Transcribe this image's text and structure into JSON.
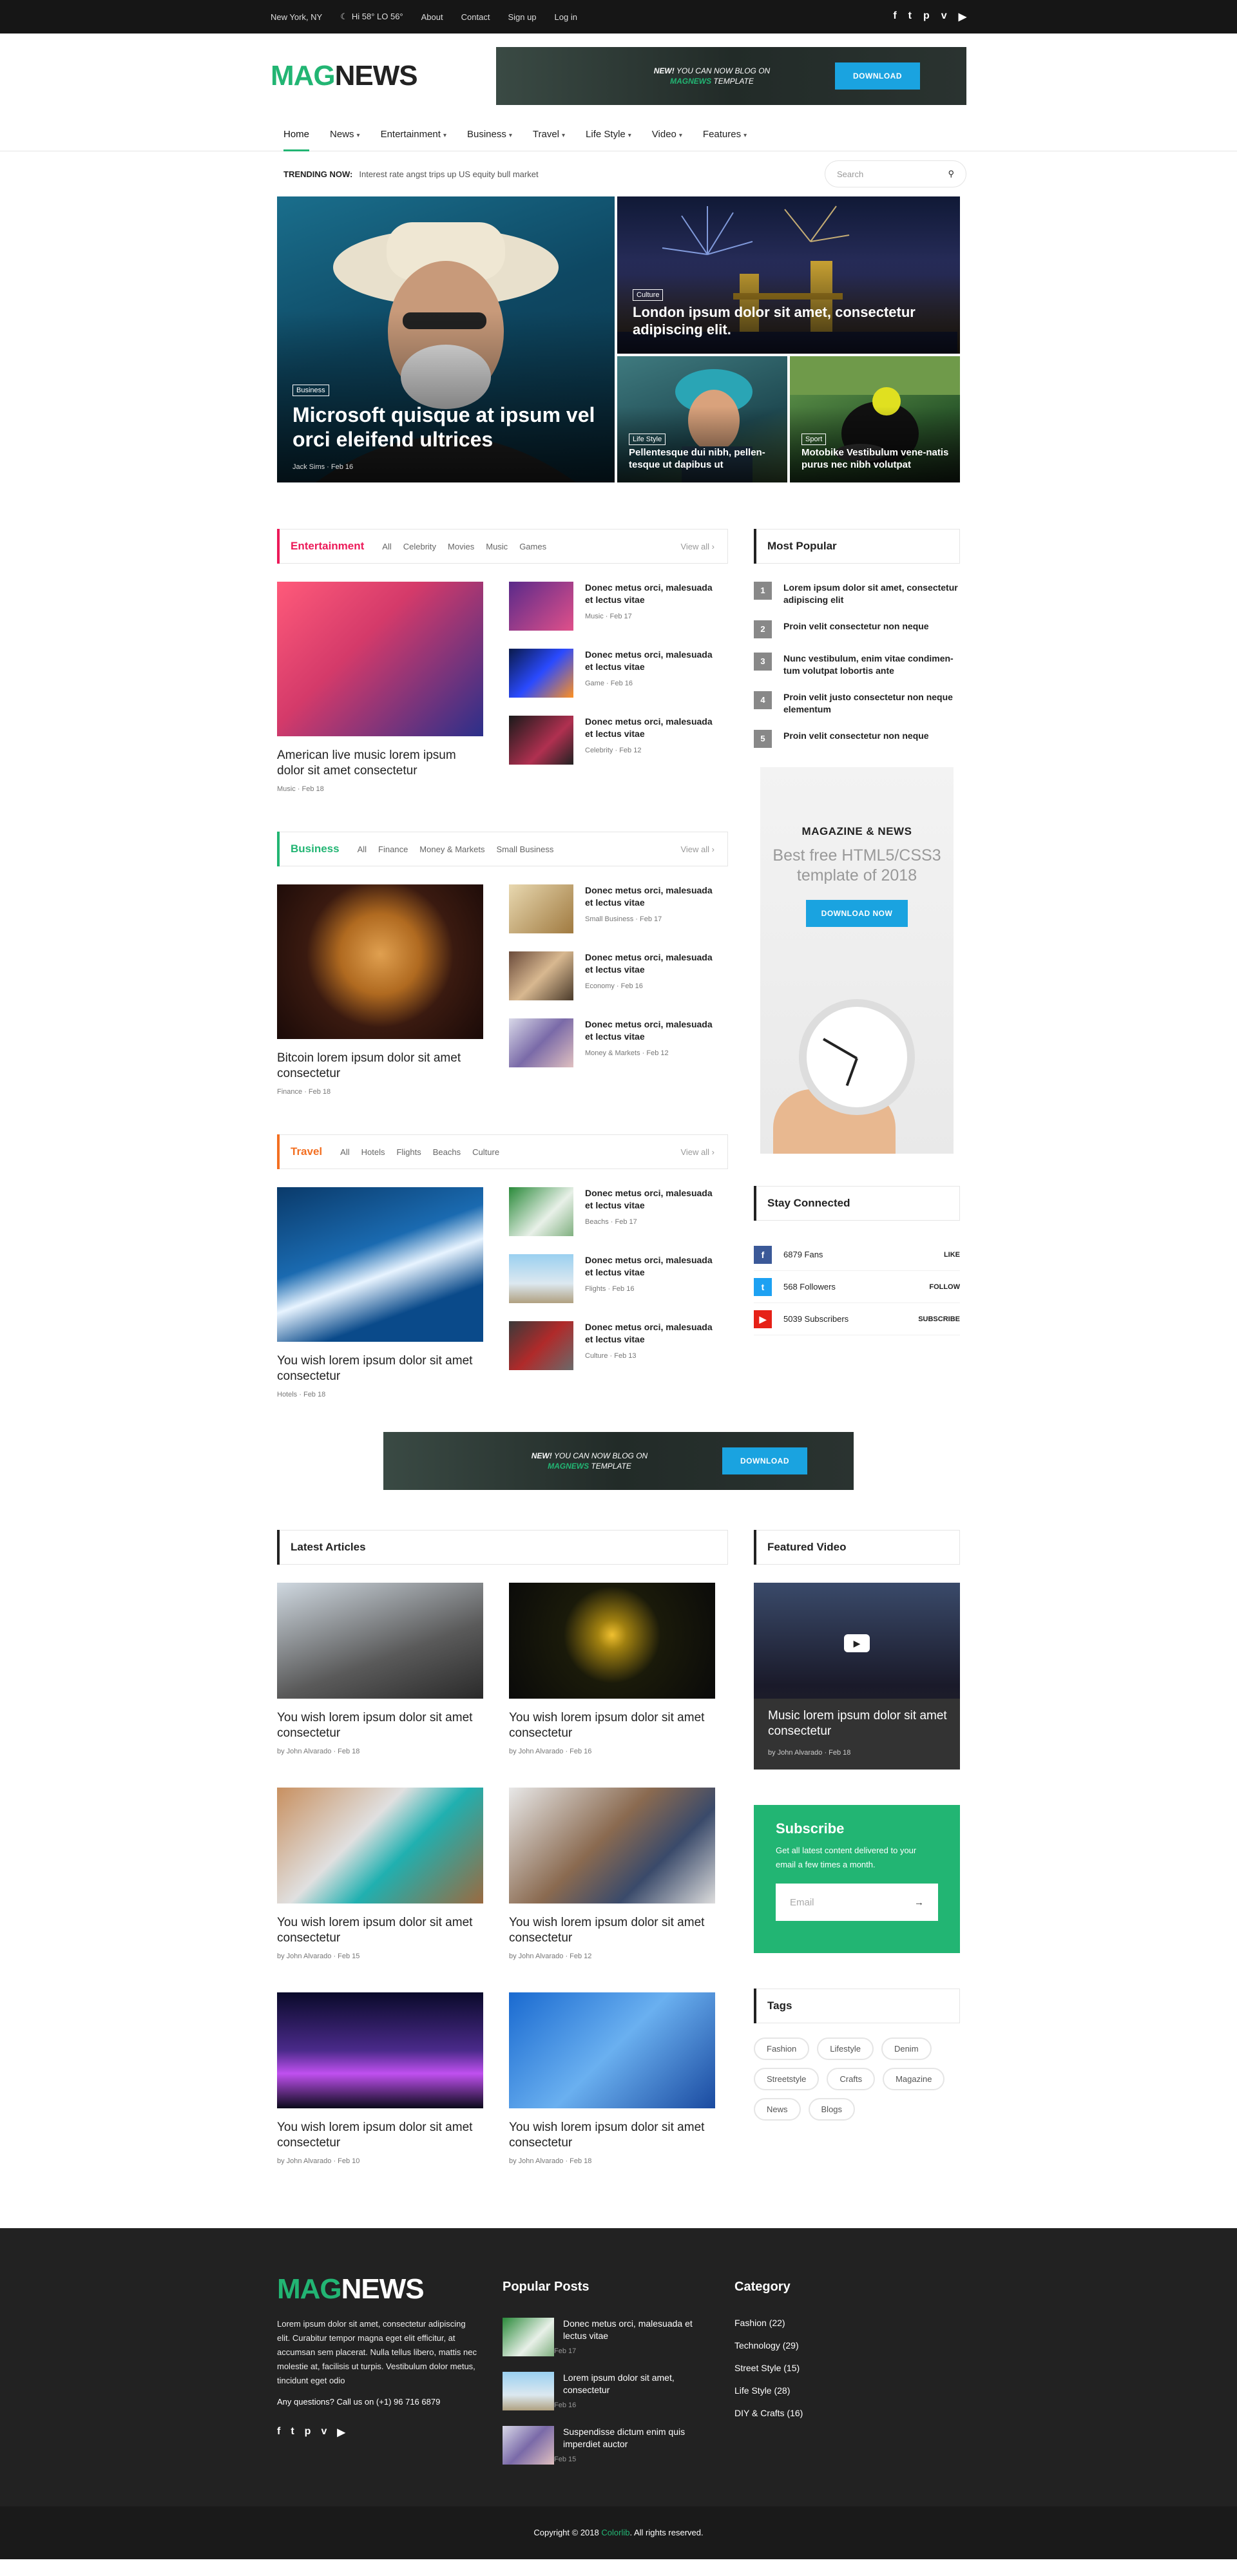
{
  "topbar": {
    "location": "New York, NY",
    "weather": "Hi 58° LO 56°",
    "links": [
      "About",
      "Contact",
      "Sign up",
      "Log in"
    ],
    "social_icons": [
      "facebook-icon",
      "twitter-icon",
      "pinterest-icon",
      "vimeo-icon",
      "youtube-icon"
    ]
  },
  "header": {
    "logo_mag": "MAG",
    "logo_news": "NEWS",
    "banner_new": "NEW!",
    "banner_line1": "YOU CAN NOW BLOG ON",
    "banner_brand": "MAGNEWS",
    "banner_line2": "TEMPLATE",
    "banner_button": "DOWNLOAD"
  },
  "nav": {
    "items": [
      "Home",
      "News",
      "Entertainment",
      "Business",
      "Travel",
      "Life Style",
      "Video",
      "Features"
    ],
    "active": "Home"
  },
  "trending": {
    "label": "TRENDING NOW:",
    "text": "Interest rate angst trips up US equity bull market",
    "search_placeholder": "Search"
  },
  "hero": {
    "main": {
      "tag": "Business",
      "title": "Microsoft quisque at ipsum vel orci eleifend ultrices",
      "author": "Jack Sims",
      "date": "Feb 16"
    },
    "top": {
      "tag": "Culture",
      "title": "London ipsum dolor sit amet, consectetur adipiscing elit."
    },
    "left": {
      "tag": "Life Style",
      "title": "Pellentesque dui nibh, pellen-tesque ut dapibus ut"
    },
    "right": {
      "tag": "Sport",
      "title": "Motobike Vestibulum vene-natis purus nec nibh volutpat"
    }
  },
  "entertainment": {
    "name": "Entertainment",
    "filters": [
      "All",
      "Celebrity",
      "Movies",
      "Music",
      "Games"
    ],
    "view_all": "View all",
    "featured": {
      "title": "American live music lorem ipsum dolor sit amet consectetur",
      "category": "Music",
      "date": "Feb 18"
    },
    "list": [
      {
        "title": "Donec metus orci, malesuada et lectus vitae",
        "category": "Music",
        "date": "Feb 17"
      },
      {
        "title": "Donec metus orci, malesuada et lectus vitae",
        "category": "Game",
        "date": "Feb 16"
      },
      {
        "title": "Donec metus orci, malesuada et lectus vitae",
        "category": "Celebrity",
        "date": "Feb 12"
      }
    ]
  },
  "business": {
    "name": "Business",
    "filters": [
      "All",
      "Finance",
      "Money & Markets",
      "Small Business"
    ],
    "view_all": "View all",
    "featured": {
      "title": "Bitcoin lorem ipsum dolor sit amet consectetur",
      "category": "Finance",
      "date": "Feb 18"
    },
    "list": [
      {
        "title": "Donec metus orci, malesuada et lectus vitae",
        "category": "Small Business",
        "date": "Feb 17"
      },
      {
        "title": "Donec metus orci, malesuada et lectus vitae",
        "category": "Economy",
        "date": "Feb 16"
      },
      {
        "title": "Donec metus orci, malesuada et lectus vitae",
        "category": "Money & Markets",
        "date": "Feb 12"
      }
    ]
  },
  "travel": {
    "name": "Travel",
    "filters": [
      "All",
      "Hotels",
      "Flights",
      "Beachs",
      "Culture"
    ],
    "view_all": "View all",
    "featured": {
      "title": "You wish lorem ipsum dolor sit amet consectetur",
      "category": "Hotels",
      "date": "Feb 18"
    },
    "list": [
      {
        "title": "Donec metus orci, malesuada et lectus vitae",
        "category": "Beachs",
        "date": "Feb 17"
      },
      {
        "title": "Donec metus orci, malesuada et lectus vitae",
        "category": "Flights",
        "date": "Feb 16"
      },
      {
        "title": "Donec metus orci, malesuada et lectus vitae",
        "category": "Culture",
        "date": "Feb 13"
      }
    ]
  },
  "popular": {
    "title": "Most Popular",
    "items": [
      {
        "n": "1",
        "t": "Lorem ipsum dolor sit amet, consectetur adipiscing elit"
      },
      {
        "n": "2",
        "t": "Proin velit consectetur non neque"
      },
      {
        "n": "3",
        "t": "Nunc vestibulum, enim vitae condimen-tum volutpat lobortis ante"
      },
      {
        "n": "4",
        "t": "Proin velit justo consectetur non neque elementum"
      },
      {
        "n": "5",
        "t": "Proin velit consectetur non neque"
      }
    ]
  },
  "ad": {
    "heading": "MAGAZINE & NEWS",
    "sub": "Best free HTML5/CSS3 template of 2018",
    "button": "DOWNLOAD NOW"
  },
  "stay": {
    "title": "Stay Connected",
    "rows": [
      {
        "label": "6879 Fans",
        "action": "LIKE",
        "color": "#3b5998",
        "icon": "f"
      },
      {
        "label": "568 Followers",
        "action": "FOLLOW",
        "color": "#1da1f2",
        "icon": "t"
      },
      {
        "label": "5039 Subscribers",
        "action": "SUBSCRIBE",
        "color": "#e62117",
        "icon": "▶"
      }
    ]
  },
  "latest": {
    "title": "Latest Articles",
    "cards": [
      {
        "title": "You wish lorem ipsum dolor sit amet consectetur",
        "author": "by John Alvarado",
        "date": "Feb 18"
      },
      {
        "title": "You wish lorem ipsum dolor sit amet consectetur",
        "author": "by John Alvarado",
        "date": "Feb 16"
      },
      {
        "title": "You wish lorem ipsum dolor sit amet consectetur",
        "author": "by John Alvarado",
        "date": "Feb 15"
      },
      {
        "title": "You wish lorem ipsum dolor sit amet consectetur",
        "author": "by John Alvarado",
        "date": "Feb 12"
      },
      {
        "title": "You wish lorem ipsum dolor sit amet consectetur",
        "author": "by John Alvarado",
        "date": "Feb 10"
      },
      {
        "title": "You wish lorem ipsum dolor sit amet consectetur",
        "author": "by John Alvarado",
        "date": "Feb 18"
      }
    ]
  },
  "video": {
    "title": "Featured Video",
    "caption": "Music lorem ipsum dolor sit amet consectetur",
    "author": "by John Alvarado",
    "date": "Feb 18"
  },
  "subscribe": {
    "title": "Subscribe",
    "desc": "Get all latest content delivered to your email a few times a month.",
    "placeholder": "Email"
  },
  "tags": {
    "title": "Tags",
    "items": [
      "Fashion",
      "Lifestyle",
      "Denim",
      "Streetstyle",
      "Crafts",
      "Magazine",
      "News",
      "Blogs"
    ]
  },
  "footer": {
    "about": "Lorem ipsum dolor sit amet, consectetur adipiscing elit. Curabitur tempor magna eget elit efficitur, at accumsan sem placerat. Nulla tellus libero, mattis nec molestie at, facilisis ut turpis. Vestibulum dolor metus, tincidunt eget odio",
    "call": "Any questions? Call us on (+1) 96 716 6879",
    "popular_title": "Popular Posts",
    "posts": [
      {
        "title": "Donec metus orci, malesuada et lectus vitae",
        "date": "Feb 17"
      },
      {
        "title": "Lorem ipsum dolor sit amet, consectetur",
        "date": "Feb 16"
      },
      {
        "title": "Suspendisse dictum enim quis imperdiet auctor",
        "date": "Feb 15"
      }
    ],
    "category_title": "Category",
    "categories": [
      "Fashion (22)",
      "Technology (29)",
      "Street Style (15)",
      "Life Style (28)",
      "DIY & Crafts (16)"
    ],
    "copyright_pre": "Copyright © 2018",
    "copyright_brand": "Colorlib",
    "copyright_post": ". All rights reserved."
  },
  "colors": {
    "green": "#22b573",
    "pink": "#ec1a59",
    "orange": "#f36f21",
    "blue": "#1aa3e0"
  }
}
